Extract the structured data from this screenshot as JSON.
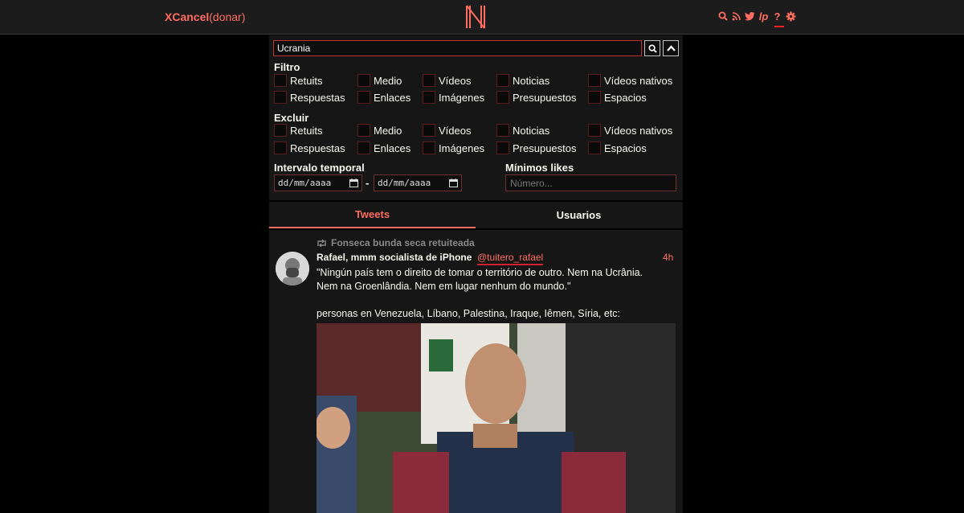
{
  "navbar": {
    "brand": "XCancel",
    "donate": "(donar)",
    "logo_letter": "N",
    "icons": [
      "search-icon",
      "rss-icon",
      "twitter-icon",
      "lp-icon",
      "help-icon",
      "gear-icon"
    ],
    "lp_text": "lp",
    "help_text": "?"
  },
  "search": {
    "value": "Ucrania",
    "search_button": "🔍",
    "collapse_button": "^"
  },
  "filter": {
    "title": "Filtro",
    "options": [
      "Retuits",
      "Medio",
      "Vídeos",
      "Noticias",
      "Vídeos nativos",
      "Respuestas",
      "Enlaces",
      "Imágenes",
      "Presupuestos",
      "Espacios"
    ]
  },
  "exclude": {
    "title": "Excluir",
    "options": [
      "Retuits",
      "Medio",
      "Vídeos",
      "Noticias",
      "Vídeos nativos",
      "Respuestas",
      "Enlaces",
      "Imágenes",
      "Presupuestos",
      "Espacios"
    ]
  },
  "date_range": {
    "label": "Intervalo temporal",
    "from_placeholder": "dd/mm/aaaa",
    "to_placeholder": "dd/mm/aaaa",
    "separator": "-"
  },
  "min_likes": {
    "label": "Mínimos likes",
    "placeholder": "Número..."
  },
  "tabs": {
    "tweets": "Tweets",
    "users": "Usuarios"
  },
  "tweet": {
    "retweet_header": "Fonseca bunda seca retuiteada",
    "fullname": "Rafael, mmm socialista de iPhone",
    "username": "@tuitero_rafael",
    "date": "4h",
    "text_line1": "\"Ningún país tem o direito de tomar o território de outro. Nem na Ucrânia.",
    "text_line2": "Nem na Groenlândia. Nem em lugar nenhum do mundo.\"",
    "text_line3": "personas en Venezuela, Líbano, Palestina, Iraque, Iêmen, Síria, etc:"
  },
  "colors": {
    "accent": "#ff6c60",
    "background": "#000000",
    "panel": "#161616",
    "navbar": "#1c1c1c"
  }
}
